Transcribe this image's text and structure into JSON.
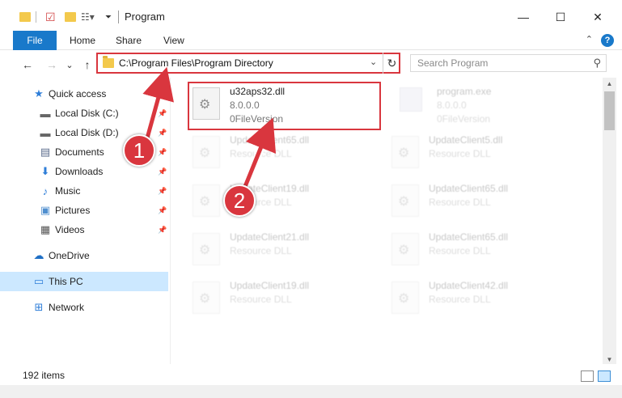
{
  "window": {
    "title": "Program",
    "minimize_glyph": "—",
    "maximize_glyph": "☐",
    "close_glyph": "✕"
  },
  "ribbon": {
    "tabs": [
      "File",
      "Home",
      "Share",
      "View"
    ],
    "help_glyph": "?",
    "collapse_glyph": "⌃"
  },
  "nav": {
    "back_glyph": "←",
    "forward_glyph": "→",
    "recent_glyph": "⌄",
    "up_glyph": "↑",
    "address": "C:\\Program Files\\Program Directory",
    "address_dropdown_glyph": "⌄",
    "refresh_glyph": "↻",
    "search_placeholder": "Search Program",
    "search_glyph": "⚲"
  },
  "sidebar": {
    "items": [
      {
        "label": "Quick access",
        "icon": "star-icon",
        "glyph": "★",
        "color": "#2f7ed8",
        "pinned": false
      },
      {
        "label": "Local Disk (C:)",
        "icon": "drive-icon",
        "glyph": "▬",
        "color": "#666666",
        "pinned": true
      },
      {
        "label": "Local Disk (D:)",
        "icon": "drive-icon",
        "glyph": "▬",
        "color": "#666666",
        "pinned": true
      },
      {
        "label": "Documents",
        "icon": "document-icon",
        "glyph": "▤",
        "color": "#5b6c8c",
        "pinned": true
      },
      {
        "label": "Downloads",
        "icon": "download-icon",
        "glyph": "⬇",
        "color": "#2f7ed8",
        "pinned": true
      },
      {
        "label": "Music",
        "icon": "music-icon",
        "glyph": "♪",
        "color": "#2f7ed8",
        "pinned": true
      },
      {
        "label": "Pictures",
        "icon": "pictures-icon",
        "glyph": "▣",
        "color": "#4f8fcf",
        "pinned": true
      },
      {
        "label": "Videos",
        "icon": "video-icon",
        "glyph": "▦",
        "color": "#555555",
        "pinned": true
      },
      {
        "label": "OneDrive",
        "icon": "cloud-icon",
        "glyph": "☁",
        "color": "#1f6fc5",
        "pinned": false
      },
      {
        "label": "This PC",
        "icon": "computer-icon",
        "glyph": "▭",
        "color": "#2f7ed8",
        "pinned": false
      },
      {
        "label": "Network",
        "icon": "network-icon",
        "glyph": "⊞",
        "color": "#2f7ed8",
        "pinned": false
      }
    ],
    "pin_glyph": "📌"
  },
  "files": {
    "highlighted": {
      "name": "u32aps32.dll",
      "line2": "8.0.0.0",
      "line3": "0FileVersion"
    },
    "exe": {
      "name": "program.exe",
      "line2": "8.0.0.0",
      "line3": "0FileVersion"
    },
    "grid": [
      {
        "name": "UpdateClient65.dll",
        "sub": "Resource DLL"
      },
      {
        "name": "UpdateClient5.dll",
        "sub": "Resource DLL"
      },
      {
        "name": "UpdateClient19.dll",
        "sub": "Resource DLL"
      },
      {
        "name": "UpdateClient65.dll",
        "sub": "Resource DLL"
      },
      {
        "name": "UpdateClient21.dll",
        "sub": "Resource DLL"
      },
      {
        "name": "UpdateClient65.dll",
        "sub": "Resource DLL"
      },
      {
        "name": "UpdateClient19.dll",
        "sub": "Resource DLL"
      },
      {
        "name": "UpdateClient42.dll",
        "sub": "Resource DLL"
      }
    ]
  },
  "status": {
    "count": "192 items"
  },
  "annotations": {
    "callout_1": "1",
    "callout_2": "2",
    "accent_color": "#d9363e"
  }
}
